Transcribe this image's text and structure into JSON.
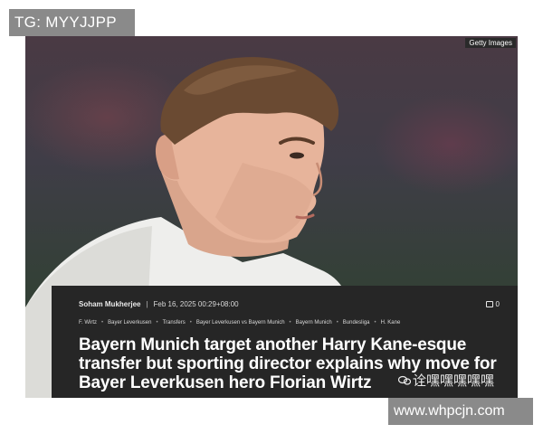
{
  "watermark_top": "TG: MYYJJPP",
  "photo": {
    "credit": "Getty Images",
    "icon": "player-photo"
  },
  "article": {
    "author": "Soham Mukherjee",
    "date": "Feb 16, 2025 00:29+08:00",
    "comments": "0",
    "tags": [
      "F. Wirtz",
      "Bayer Leverkusen",
      "Transfers",
      "Bayer Leverkusen vs Bayern Munich",
      "Bayern Munich",
      "Bundesliga",
      "H. Kane"
    ],
    "headline": "Bayern Munich target another Harry Kane-esque transfer but sporting director explains why move for Bayer Leverkusen hero Florian Wirtz"
  },
  "watermark_cn": "诠嘿嘿嘿嘿嘿",
  "watermark_bottom": "www.whpcjn.com",
  "colors": {
    "card_bg": "#262626",
    "watermark_bg": "#8a8a8a"
  }
}
